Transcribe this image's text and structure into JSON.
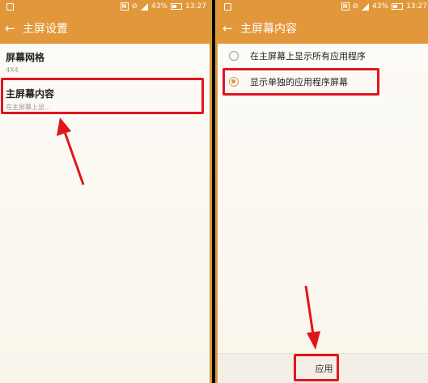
{
  "status_bar": {
    "battery_text": "43%",
    "time": "13:27",
    "n_icon": "N",
    "mute_icon": "⊘"
  },
  "left_screen": {
    "title": "主屏设置",
    "items": [
      {
        "title": "屏幕网格",
        "subtitle": "4X4"
      },
      {
        "title": "主屏幕内容",
        "subtitle": "在主屏幕上显..."
      }
    ]
  },
  "right_screen": {
    "title": "主屏幕内容",
    "options": [
      {
        "label": "在主屏幕上显示所有应用程序",
        "selected": false
      },
      {
        "label": "显示单独的应用程序屏幕",
        "selected": true
      }
    ],
    "apply_label": "应用"
  },
  "colors": {
    "accent": "#e2973a",
    "highlight_border": "#e0161f",
    "frame_border": "#d49a3d"
  }
}
